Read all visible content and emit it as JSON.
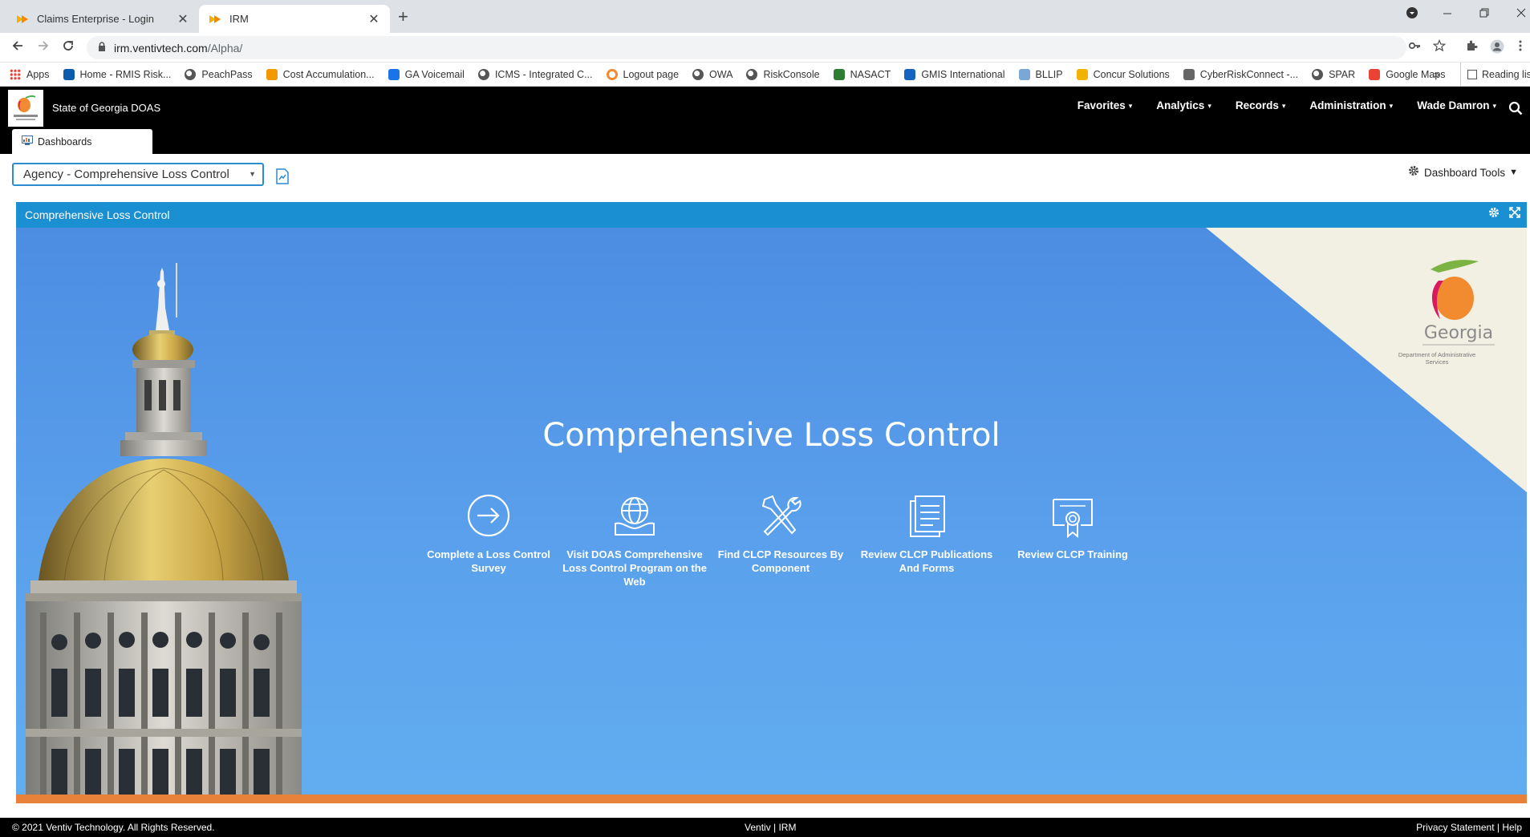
{
  "browser": {
    "tabs": [
      {
        "title": "Claims Enterprise - Login",
        "icon": "ventiv-tab-icon",
        "active": false
      },
      {
        "title": "IRM",
        "icon": "ventiv-tab-icon",
        "active": true
      }
    ],
    "close_glyph": "✕",
    "new_tab_glyph": "+",
    "url_host": "irm.ventivtech.com",
    "url_path": "/Alpha/",
    "bookmarks": [
      {
        "label": "Apps",
        "icon": "apps-grid-icon",
        "color": "#e94235"
      },
      {
        "label": "Home - RMIS Risk...",
        "icon": "sharepoint-icon",
        "color": "#0b5cad"
      },
      {
        "label": "PeachPass",
        "icon": "globe-icon",
        "color": "#555555"
      },
      {
        "label": "Cost Accumulation...",
        "icon": "orange-app-icon",
        "color": "#f29900"
      },
      {
        "label": "GA Voicemail",
        "icon": "calendar-icon",
        "color": "#1a73e8"
      },
      {
        "label": "ICMS - Integrated C...",
        "icon": "globe-icon",
        "color": "#555555"
      },
      {
        "label": "Logout page",
        "icon": "ring-icon",
        "color": "#f28b30"
      },
      {
        "label": "OWA",
        "icon": "globe-icon",
        "color": "#555555"
      },
      {
        "label": "RiskConsole",
        "icon": "globe-icon",
        "color": "#555555"
      },
      {
        "label": "NASACT",
        "icon": "star-logo-icon",
        "color": "#2e7d32"
      },
      {
        "label": "GMIS International",
        "icon": "gmis-icon",
        "color": "#1565c0"
      },
      {
        "label": "BLLIP",
        "icon": "document-icon",
        "color": "#7aa7d6"
      },
      {
        "label": "Concur Solutions",
        "icon": "concur-icon",
        "color": "#f2b300"
      },
      {
        "label": "CyberRiskConnect -...",
        "icon": "dots-icon",
        "color": "#666666"
      },
      {
        "label": "SPAR",
        "icon": "globe-icon",
        "color": "#555555"
      },
      {
        "label": "Google Maps",
        "icon": "map-pin-icon",
        "color": "#ea4335"
      }
    ],
    "more_bookmarks": "»",
    "reading_list": "Reading list"
  },
  "app": {
    "org_name": "State of Georgia DOAS",
    "nav": [
      {
        "label": "Favorites"
      },
      {
        "label": "Analytics"
      },
      {
        "label": "Records"
      },
      {
        "label": "Administration"
      },
      {
        "label": "Wade Damron"
      }
    ],
    "nav_caret": "▾",
    "dashboard_tab": "Dashboards"
  },
  "toolbar": {
    "selected_dashboard": "Agency - Comprehensive Loss Control",
    "dashboard_tools": "Dashboard Tools",
    "tools_caret": "▼"
  },
  "widget": {
    "title": "Comprehensive Loss Control",
    "hero_title": "Comprehensive Loss Control",
    "logo_text": "Georgia",
    "logo_subtext": "Department of Administrative Services",
    "actions": [
      {
        "label": "Complete a Loss Control Survey",
        "icon": "arrow-circle-icon"
      },
      {
        "label": "Visit DOAS Comprehensive Loss Control Program on the Web",
        "icon": "globe-hand-icon"
      },
      {
        "label": "Find CLCP Resources By Component",
        "icon": "tools-icon"
      },
      {
        "label": "Review CLCP Publications And Forms",
        "icon": "documents-icon"
      },
      {
        "label": "Review CLCP Training",
        "icon": "certificate-icon"
      }
    ]
  },
  "footer": {
    "copyright": "© 2021 Ventiv Technology. All Rights Reserved.",
    "center": "Ventiv | IRM",
    "right": "Privacy Statement  |  Help"
  },
  "colors": {
    "header_bg": "#000000",
    "widget_head": "#1a8fd1",
    "hero_blue": "#5aa0ec",
    "accent_orange": "#e8823a",
    "select_border": "#2b8ccf"
  }
}
